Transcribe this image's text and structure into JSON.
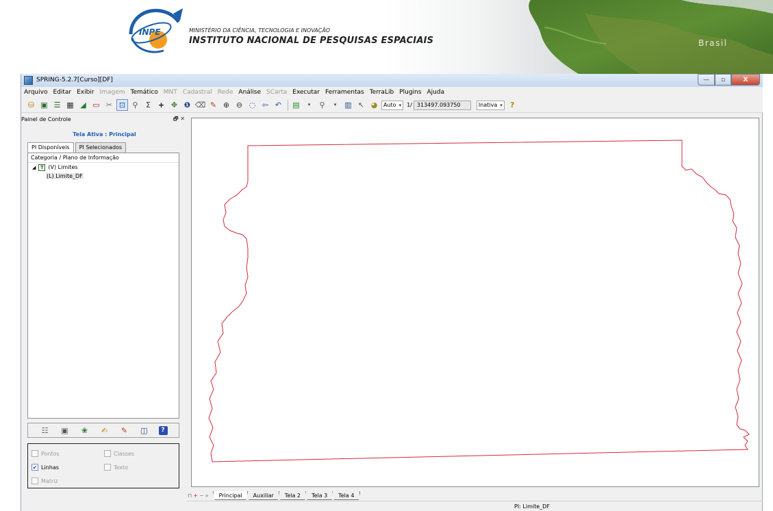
{
  "banner": {
    "ministry": "MINISTÉRIO DA CIÊNCIA, TECNOLOGIA E INOVAÇÃO",
    "institute": "INSTITUTO NACIONAL DE PESQUISAS ESPACIAIS",
    "logo_text": "INPE",
    "map_label": "Brasil"
  },
  "window": {
    "title": "SPRING-5.2.7[Curso][DF]",
    "controls": {
      "minimize": "—",
      "maximize": "▫",
      "close": "X"
    }
  },
  "menu": [
    {
      "label": "Arquivo",
      "enabled": true
    },
    {
      "label": "Editar",
      "enabled": true
    },
    {
      "label": "Exibir",
      "enabled": true
    },
    {
      "label": "Imagem",
      "enabled": false
    },
    {
      "label": "Temático",
      "enabled": true
    },
    {
      "label": "MNT",
      "enabled": false
    },
    {
      "label": "Cadastral",
      "enabled": false
    },
    {
      "label": "Rede",
      "enabled": false
    },
    {
      "label": "Análise",
      "enabled": true
    },
    {
      "label": "SCarta",
      "enabled": false
    },
    {
      "label": "Executar",
      "enabled": true
    },
    {
      "label": "Ferramentas",
      "enabled": true
    },
    {
      "label": "TerraLib",
      "enabled": true
    },
    {
      "label": "Plugins",
      "enabled": true
    },
    {
      "label": "Ajuda",
      "enabled": true
    }
  ],
  "toolbar": {
    "zoom_mode": "Auto",
    "scale_prefix": "1/",
    "scale_value": "313497.093750",
    "state": "Inativa"
  },
  "panel": {
    "title": "Painel de Controle",
    "controls": "🗗 ✕",
    "active_screen": "Tela Ativa : Principal",
    "tabs": [
      "PI Disponíveis",
      "PI Selecionados"
    ],
    "tree_header": "Categoria / Plano de Informação",
    "category": "(V) Limites",
    "category_icon": "T",
    "plan": "(L) Limite_DF",
    "checkboxes": {
      "pontos": {
        "label": "Pontos",
        "checked": false,
        "enabled": false
      },
      "classes": {
        "label": "Classes",
        "checked": false,
        "enabled": false
      },
      "linhas": {
        "label": "Linhas",
        "checked": true,
        "enabled": true
      },
      "texto": {
        "label": "Texto",
        "checked": false,
        "enabled": false
      },
      "matriz": {
        "label": "Matriz",
        "checked": false,
        "enabled": false
      }
    }
  },
  "screen_tabs": [
    "Principal",
    "Auxiliar",
    "Tela 2",
    "Tela 3",
    "Tela 4"
  ],
  "status": {
    "pi": "PI: Limite_DF"
  },
  "colors": {
    "boundary": "#d02a3a",
    "active_label": "#1f5fb5"
  }
}
